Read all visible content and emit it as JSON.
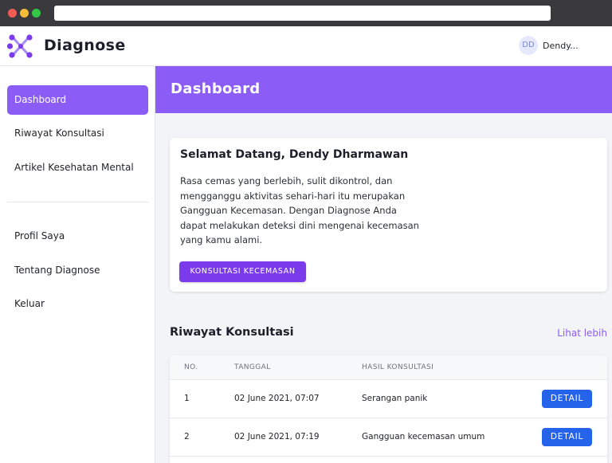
{
  "app": {
    "brand": "Diagnose",
    "user": {
      "initials": "DD",
      "name": "Dendy..."
    }
  },
  "sidebar": {
    "items": [
      {
        "label": "Dashboard",
        "active": true
      },
      {
        "label": "Riwayat Konsultasi",
        "active": false
      },
      {
        "label": "Artikel Kesehatan Mental",
        "active": false
      },
      {
        "label": "Profil Saya",
        "active": false
      },
      {
        "label": "Tentang Diagnose",
        "active": false
      },
      {
        "label": "Keluar",
        "active": false
      }
    ]
  },
  "main": {
    "title": "Dashboard",
    "welcome": {
      "title": "Selamat Datang, Dendy Dharmawan",
      "description": "Rasa cemas yang berlebih, sulit dikontrol, dan mengganggu aktivitas sehari-hari itu merupakan Gangguan Kecemasan. Dengan Diagnose Anda dapat melakukan deteksi dini mengenai kecemasan yang kamu alami.",
      "cta_label": "KONSULTASI KECEMASAN"
    },
    "history": {
      "title": "Riwayat Konsultasi",
      "more_label": "Lihat lebih",
      "columns": [
        "NO.",
        "TANGGAL",
        "HASIL KONSULTASI"
      ],
      "rows": [
        {
          "no": "1",
          "date": "02 June 2021, 07:07",
          "result": "Serangan panik",
          "action": "DETAIL"
        },
        {
          "no": "2",
          "date": "02 June 2021, 07:19",
          "result": "Gangguan kecemasan umum",
          "action": "DETAIL"
        }
      ]
    }
  },
  "colors": {
    "accent": "#8b5cf6",
    "cta": "#7c3aed",
    "detail_button": "#2563eb"
  },
  "icons": {
    "logo": "diagnose-logo-icon"
  }
}
